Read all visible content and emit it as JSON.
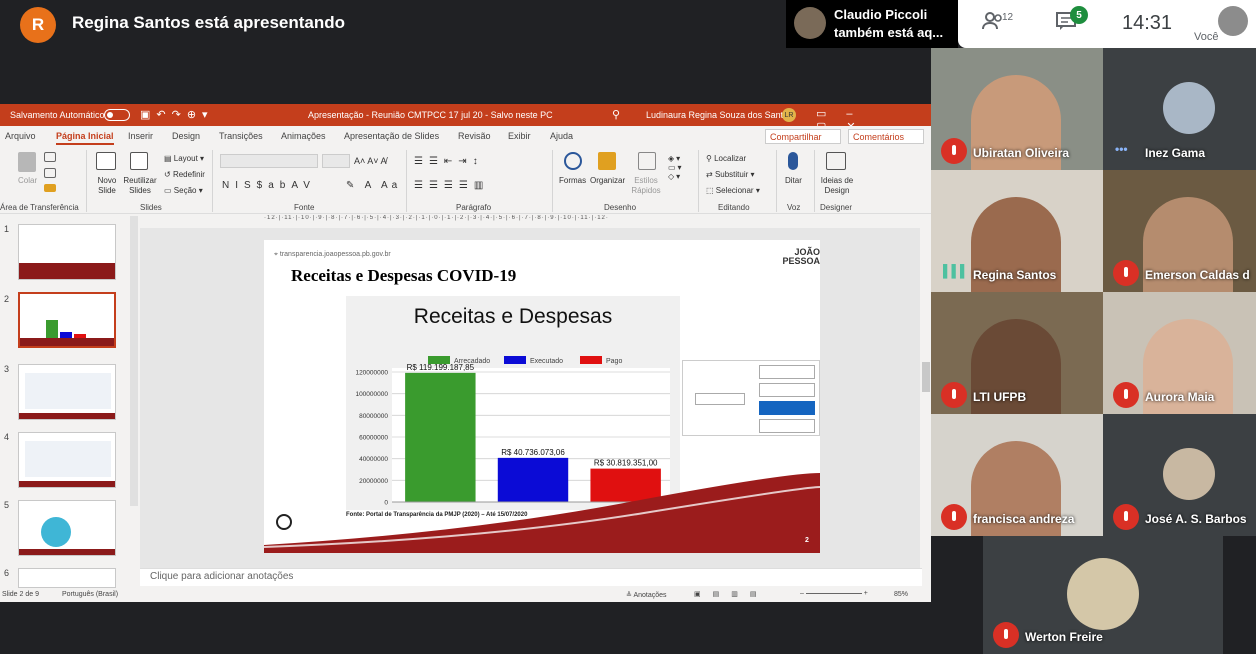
{
  "meeting": {
    "presenter_initial": "R",
    "presenter_text": "Regina Santos está apresentando",
    "notification_name": "Claudio Piccoli",
    "notification_text": "também está aq...",
    "people_count": "12",
    "chat_count": "5",
    "time": "14:31",
    "you_label": "Você"
  },
  "ppt": {
    "autosave": "Salvamento Automático",
    "doc_title": "Apresentação - Reunião CMTPCC 17 jul 20  -  Salvo neste PC",
    "user": "Ludinaura Regina Souza dos Santos",
    "user_initials": "LR",
    "tabs": [
      "Arquivo",
      "Página Inicial",
      "Inserir",
      "Design",
      "Transições",
      "Animações",
      "Apresentação de Slides",
      "Revisão",
      "Exibir",
      "Ajuda"
    ],
    "share": "Compartilhar",
    "comments": "Comentários",
    "ribbon": {
      "colar": "Colar",
      "novo_slide": "Novo Slide",
      "reutilizar": "Reutilizar Slides",
      "layout": "Layout",
      "redefinir": "Redefinir",
      "secao": "Seção",
      "formas": "Formas",
      "organizar": "Organizar",
      "estilos": "Estilos Rápidos",
      "localizar": "Localizar",
      "substituir": "Substituir",
      "selecionar": "Selecionar",
      "ditar": "Ditar",
      "ideias": "Ideias de Design",
      "groups": {
        "transfer": "Área de Transferência",
        "slides": "Slides",
        "fonte": "Fonte",
        "paragrafo": "Parágrafo",
        "desenho": "Desenho",
        "editando": "Editando",
        "voz": "Voz",
        "designer": "Designer"
      }
    },
    "thumb_numbers": [
      "1",
      "2",
      "3",
      "4",
      "5",
      "6"
    ],
    "notes": "Clique para adicionar anotações",
    "status_slide": "Slide 2 de 9",
    "status_lang": "Português (Brasil)",
    "status_notes": "Anotações",
    "zoom": "85%"
  },
  "slide": {
    "url": "transparencia.joaopessoa.pb.gov.br",
    "logo": "JOÃO PESSOA",
    "title": "Receitas e Despesas COVID-19",
    "source": "Fonte: Portal de Transparência da PMJP (2020) – Até 15/07/2020",
    "page_number": "2"
  },
  "chart_data": {
    "type": "bar",
    "title": "Receitas e Despesas",
    "categories": [
      "Arrecadado",
      "Executado",
      "Pago"
    ],
    "values": [
      119199187.85,
      40736073.06,
      30819351.0
    ],
    "data_labels": [
      "R$ 119.199.187,85",
      "R$ 40.736.073,06",
      "R$ 30.819.351,00"
    ],
    "colors": [
      "#3a9b2e",
      "#0b0bd6",
      "#e01010"
    ],
    "ylim": [
      0,
      120000000
    ],
    "yticks": [
      "0",
      "20000000",
      "40000000",
      "60000000",
      "80000000",
      "100000000",
      "120000000"
    ],
    "legend": [
      "Arrecadado",
      "Executado",
      "Pago"
    ],
    "legend_position": "top",
    "grid": true
  },
  "participants": [
    {
      "name": "Ubiratan Oliveira",
      "muted": true,
      "bg": "#8a8f86",
      "skin": "#c89a7a"
    },
    {
      "name": "Inez Gama",
      "muted": false,
      "bg": "#3c4043",
      "circle": "#a9b7c6"
    },
    {
      "name": "Regina Santos",
      "muted": false,
      "bg": "#d8d2c8",
      "skin": "#9a6a4e"
    },
    {
      "name": "Emerson Caldas d",
      "muted": true,
      "bg": "#6b5a42",
      "skin": "#b58c6e"
    },
    {
      "name": "LTI UFPB",
      "muted": true,
      "bg": "#7b6a52",
      "skin": "#6a4a36"
    },
    {
      "name": "Aurora Maia",
      "muted": true,
      "bg": "#c9c2b6",
      "skin": "#d9b39a"
    },
    {
      "name": "francisca andreza",
      "muted": true,
      "bg": "#d6d3cc",
      "skin": "#b07f63"
    },
    {
      "name": "José A. S. Barbos",
      "muted": true,
      "bg": "#3c4043",
      "circle": "#c8b8a2"
    },
    {
      "name": "Werton Freire",
      "muted": true,
      "bg": "#3c4043",
      "circle": "#d4c7a8"
    }
  ]
}
